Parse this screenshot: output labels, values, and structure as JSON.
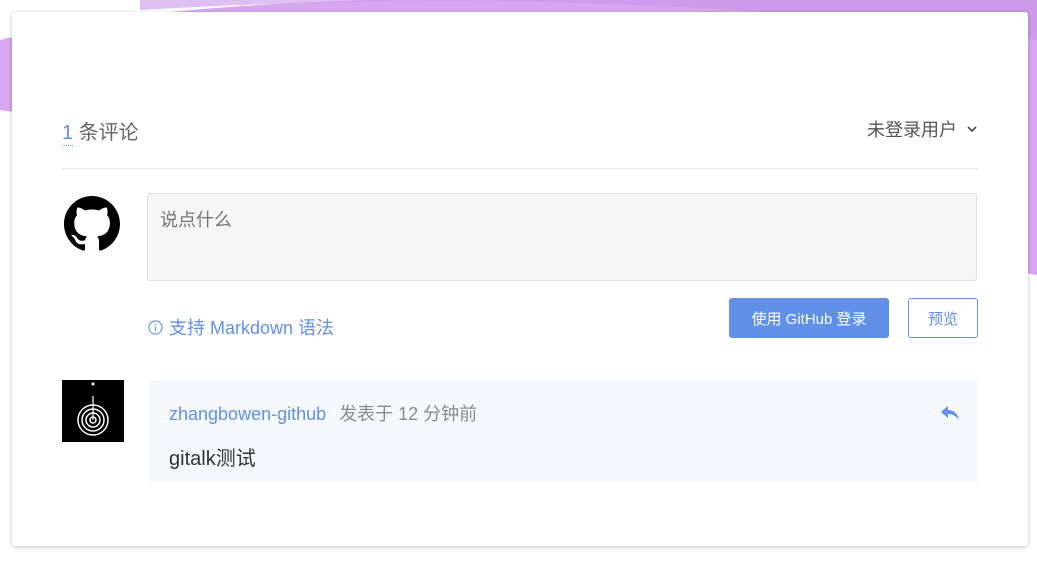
{
  "header": {
    "comment_count": "1",
    "comment_suffix": "条评论",
    "user_menu_label": "未登录用户"
  },
  "editor": {
    "placeholder": "说点什么",
    "markdown_tip": "支持 Markdown 语法",
    "login_button": "使用 GitHub 登录",
    "preview_button": "预览"
  },
  "comments": [
    {
      "author": "zhangbowen-github",
      "posted_prefix": "发表于",
      "time_ago": "12 分钟前",
      "body": "gitalk测试"
    }
  ],
  "colors": {
    "accent": "#6190e8",
    "comment_bg": "#f5f8fd",
    "background_wave": "#d8a6f0"
  },
  "icons": [
    "github-icon",
    "chevron-down-icon",
    "info-icon",
    "reply-icon",
    "avatar-image"
  ]
}
